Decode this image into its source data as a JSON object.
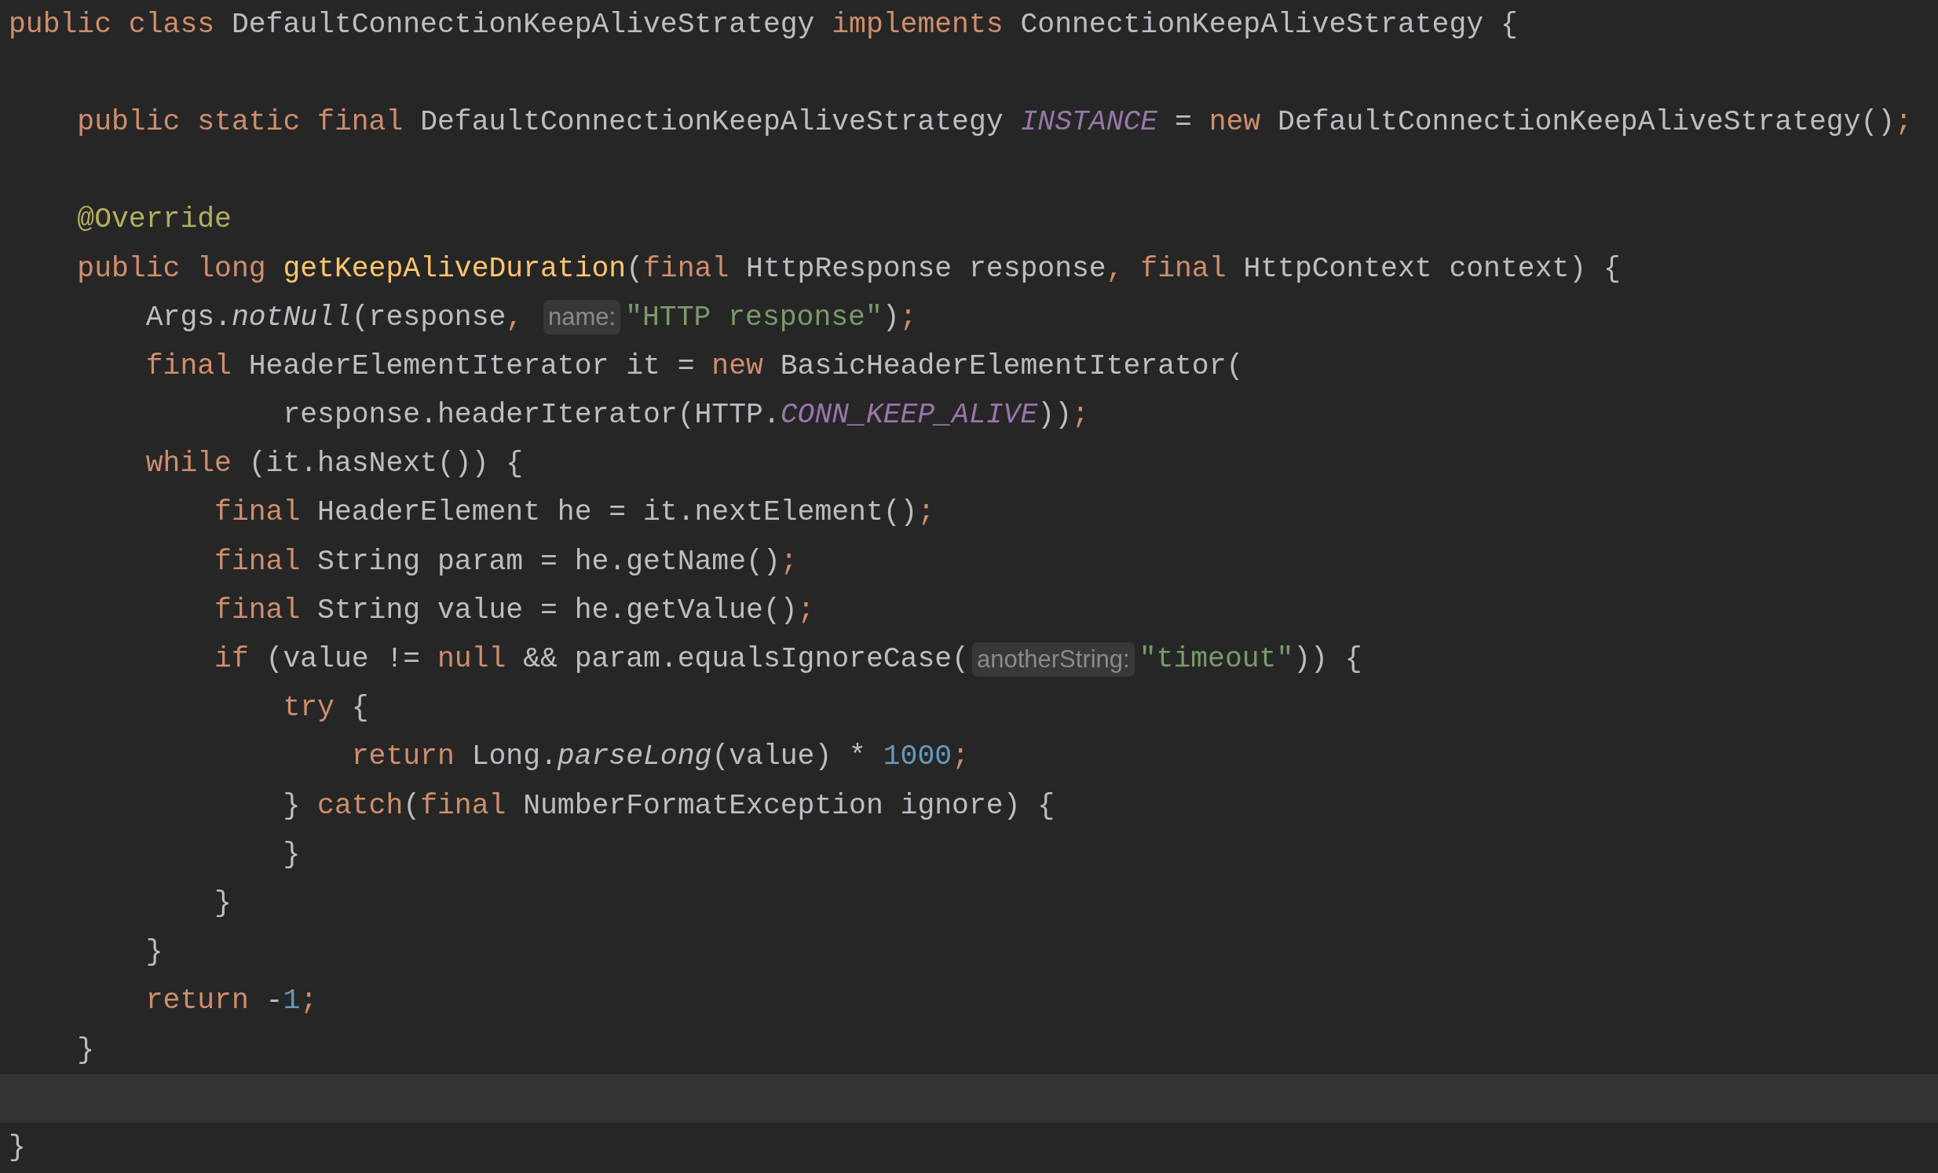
{
  "editor": {
    "lines": [
      {
        "kind": "code",
        "segments": [
          {
            "kind": "code",
            "tokens": [
              {
                "text": "public class ",
                "kind": "keyword"
              },
              {
                "text": "DefaultConnectionKeepAliveStrategy ",
                "kind": "plain"
              },
              {
                "text": "implements ",
                "kind": "keyword"
              },
              {
                "text": "ConnectionKeepAliveStrategy {",
                "kind": "plain"
              }
            ]
          }
        ]
      },
      {
        "kind": "blank"
      },
      {
        "kind": "code",
        "segments": [
          {
            "kind": "code",
            "tokens": [
              {
                "text": "    public static final ",
                "kind": "keyword"
              },
              {
                "text": "DefaultConnectionKeepAliveStrategy ",
                "kind": "plain"
              },
              {
                "text": "INSTANCE",
                "kind": "field"
              },
              {
                "text": " = ",
                "kind": "plain"
              },
              {
                "text": "new ",
                "kind": "keyword"
              },
              {
                "text": "DefaultConnectionKeepAliveStrategy()",
                "kind": "plain"
              },
              {
                "text": ";",
                "kind": "keyword"
              }
            ]
          }
        ]
      },
      {
        "kind": "blank"
      },
      {
        "kind": "code",
        "segments": [
          {
            "kind": "code",
            "tokens": [
              {
                "text": "    @Override",
                "kind": "annotation"
              }
            ]
          }
        ]
      },
      {
        "kind": "code",
        "segments": [
          {
            "kind": "code",
            "tokens": [
              {
                "text": "    public long ",
                "kind": "keyword"
              },
              {
                "text": "getKeepAliveDuration",
                "kind": "method"
              },
              {
                "text": "(",
                "kind": "plain"
              },
              {
                "text": "final ",
                "kind": "keyword"
              },
              {
                "text": "HttpResponse response",
                "kind": "plain"
              },
              {
                "text": ", final ",
                "kind": "keyword"
              },
              {
                "text": "HttpContext context) {",
                "kind": "plain"
              }
            ]
          }
        ]
      },
      {
        "kind": "code",
        "segments": [
          {
            "kind": "code",
            "tokens": [
              {
                "text": "        Args.",
                "kind": "plain"
              },
              {
                "text": "notNull",
                "kind": "static"
              },
              {
                "text": "(response",
                "kind": "plain"
              },
              {
                "text": ", ",
                "kind": "keyword"
              }
            ]
          },
          {
            "kind": "hint",
            "text": "name:"
          },
          {
            "kind": "code",
            "tokens": [
              {
                "text": "\"HTTP response\"",
                "kind": "string"
              },
              {
                "text": ")",
                "kind": "plain"
              },
              {
                "text": ";",
                "kind": "keyword"
              }
            ]
          }
        ]
      },
      {
        "kind": "code",
        "segments": [
          {
            "kind": "code",
            "tokens": [
              {
                "text": "        final ",
                "kind": "keyword"
              },
              {
                "text": "HeaderElementIterator it = ",
                "kind": "plain"
              },
              {
                "text": "new ",
                "kind": "keyword"
              },
              {
                "text": "BasicHeaderElementIterator(",
                "kind": "plain"
              }
            ]
          }
        ]
      },
      {
        "kind": "code",
        "segments": [
          {
            "kind": "code",
            "tokens": [
              {
                "text": "                response.headerIterator(HTTP.",
                "kind": "plain"
              },
              {
                "text": "CONN_KEEP_ALIVE",
                "kind": "field"
              },
              {
                "text": "))",
                "kind": "plain"
              },
              {
                "text": ";",
                "kind": "keyword"
              }
            ]
          }
        ]
      },
      {
        "kind": "code",
        "segments": [
          {
            "kind": "code",
            "tokens": [
              {
                "text": "        while ",
                "kind": "keyword"
              },
              {
                "text": "(it.hasNext()) {",
                "kind": "plain"
              }
            ]
          }
        ]
      },
      {
        "kind": "code",
        "segments": [
          {
            "kind": "code",
            "tokens": [
              {
                "text": "            final ",
                "kind": "keyword"
              },
              {
                "text": "HeaderElement he = it.nextElement()",
                "kind": "plain"
              },
              {
                "text": ";",
                "kind": "keyword"
              }
            ]
          }
        ]
      },
      {
        "kind": "code",
        "segments": [
          {
            "kind": "code",
            "tokens": [
              {
                "text": "            final ",
                "kind": "keyword"
              },
              {
                "text": "String param = he.getName()",
                "kind": "plain"
              },
              {
                "text": ";",
                "kind": "keyword"
              }
            ]
          }
        ]
      },
      {
        "kind": "code",
        "segments": [
          {
            "kind": "code",
            "tokens": [
              {
                "text": "            final ",
                "kind": "keyword"
              },
              {
                "text": "String value = he.getValue()",
                "kind": "plain"
              },
              {
                "text": ";",
                "kind": "keyword"
              }
            ]
          }
        ]
      },
      {
        "kind": "code",
        "segments": [
          {
            "kind": "code",
            "tokens": [
              {
                "text": "            if ",
                "kind": "keyword"
              },
              {
                "text": "(value != ",
                "kind": "plain"
              },
              {
                "text": "null ",
                "kind": "keyword"
              },
              {
                "text": "&& param.equalsIgnoreCase(",
                "kind": "plain"
              }
            ]
          },
          {
            "kind": "hint",
            "text": "anotherString:"
          },
          {
            "kind": "code",
            "tokens": [
              {
                "text": "\"timeout\"",
                "kind": "string"
              },
              {
                "text": ")) {",
                "kind": "plain"
              }
            ]
          }
        ]
      },
      {
        "kind": "code",
        "segments": [
          {
            "kind": "code",
            "tokens": [
              {
                "text": "                try ",
                "kind": "keyword"
              },
              {
                "text": "{",
                "kind": "plain"
              }
            ]
          }
        ]
      },
      {
        "kind": "code",
        "segments": [
          {
            "kind": "code",
            "tokens": [
              {
                "text": "                    return ",
                "kind": "keyword"
              },
              {
                "text": "Long.",
                "kind": "plain"
              },
              {
                "text": "parseLong",
                "kind": "static"
              },
              {
                "text": "(value) * ",
                "kind": "plain"
              },
              {
                "text": "1000",
                "kind": "number"
              },
              {
                "text": ";",
                "kind": "keyword"
              }
            ]
          }
        ]
      },
      {
        "kind": "code",
        "segments": [
          {
            "kind": "code",
            "tokens": [
              {
                "text": "                } ",
                "kind": "plain"
              },
              {
                "text": "catch",
                "kind": "keyword"
              },
              {
                "text": "(",
                "kind": "plain"
              },
              {
                "text": "final ",
                "kind": "keyword"
              },
              {
                "text": "NumberFormatException ignore) {",
                "kind": "plain"
              }
            ]
          }
        ]
      },
      {
        "kind": "code",
        "segments": [
          {
            "kind": "code",
            "tokens": [
              {
                "text": "                }",
                "kind": "plain"
              }
            ]
          }
        ]
      },
      {
        "kind": "code",
        "segments": [
          {
            "kind": "code",
            "tokens": [
              {
                "text": "            }",
                "kind": "plain"
              }
            ]
          }
        ]
      },
      {
        "kind": "code",
        "segments": [
          {
            "kind": "code",
            "tokens": [
              {
                "text": "        }",
                "kind": "plain"
              }
            ]
          }
        ]
      },
      {
        "kind": "code",
        "segments": [
          {
            "kind": "code",
            "tokens": [
              {
                "text": "        return ",
                "kind": "keyword"
              },
              {
                "text": "-",
                "kind": "plain"
              },
              {
                "text": "1",
                "kind": "number"
              },
              {
                "text": ";",
                "kind": "keyword"
              }
            ]
          }
        ]
      },
      {
        "kind": "code",
        "segments": [
          {
            "kind": "code",
            "tokens": [
              {
                "text": "    }",
                "kind": "plain"
              }
            ]
          }
        ]
      },
      {
        "kind": "current"
      },
      {
        "kind": "code",
        "segments": [
          {
            "kind": "code",
            "tokens": [
              {
                "text": "}",
                "kind": "plain"
              }
            ]
          }
        ]
      }
    ]
  }
}
